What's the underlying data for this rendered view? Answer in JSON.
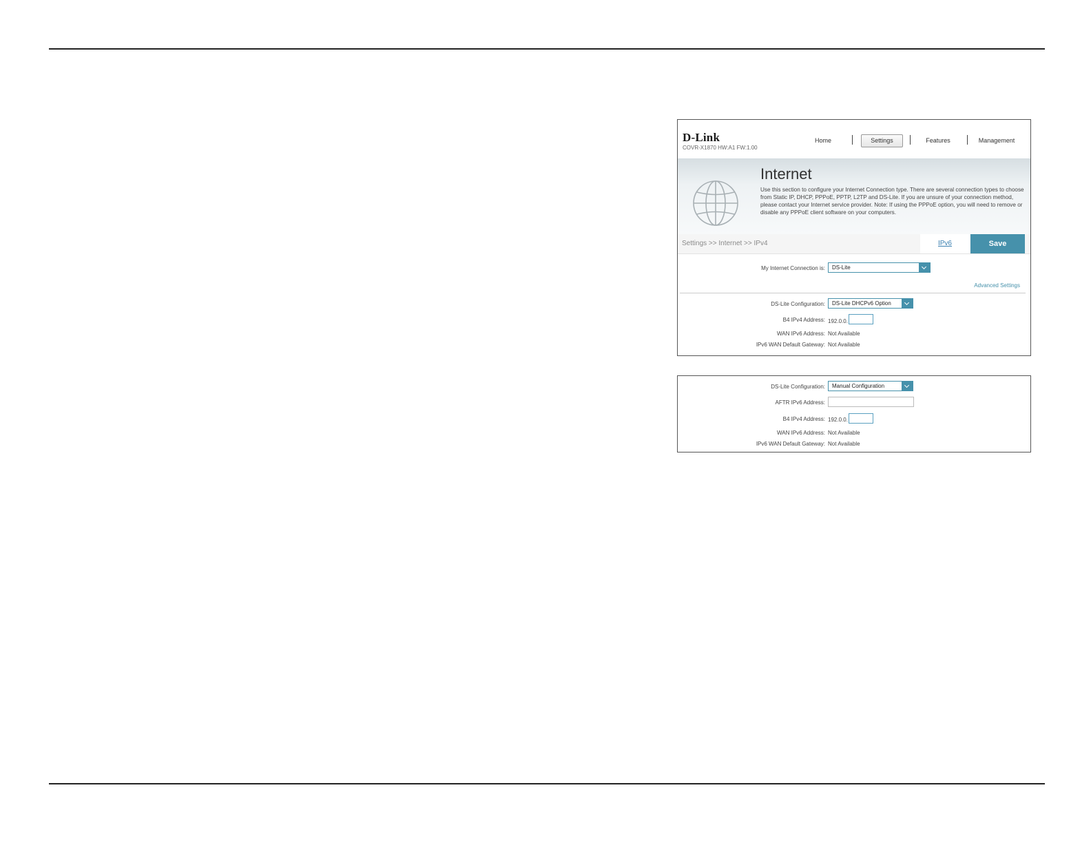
{
  "header": {
    "logo": "D-Link",
    "model": "COVR-X1870 HW:A1 FW:1.00",
    "nav": [
      "Home",
      "Settings",
      "Features",
      "Management"
    ],
    "active_nav": "Settings"
  },
  "banner": {
    "title": "Internet",
    "description": "Use this section to configure your Internet Connection type. There are several connection types to choose from Static IP, DHCP, PPPoE, PPTP, L2TP and DS-Lite. If you are unsure of your connection method, please contact your Internet service provider. Note: If using the PPPoE option, you will need to remove or disable any PPPoE client software on your computers."
  },
  "toolbar": {
    "breadcrumb": "Settings >> Internet >> IPv4",
    "ipv6_link": "IPv6",
    "save": "Save"
  },
  "connection": {
    "label": "My Internet Connection is:",
    "value": "DS-Lite",
    "advanced": "Advanced Settings"
  },
  "panel1": {
    "dslite_label": "DS-Lite Configuration:",
    "dslite_value": "DS-Lite DHCPv6 Option",
    "b4_label": "B4 IPv4 Address:",
    "b4_prefix": "192.0.0.",
    "b4_value": "",
    "wan_label": "WAN IPv6 Address:",
    "wan_value": "Not Available",
    "gw_label": "IPv6 WAN Default Gateway:",
    "gw_value": "Not Available"
  },
  "panel2": {
    "dslite_label": "DS-Lite Configuration:",
    "dslite_value": "Manual Configuration",
    "aftr_label": "AFTR IPv6 Address:",
    "aftr_value": "",
    "b4_label": "B4 IPv4 Address:",
    "b4_prefix": "192.0.0.",
    "b4_value": "",
    "wan_label": "WAN IPv6 Address:",
    "wan_value": "Not Available",
    "gw_label": "IPv6 WAN Default Gateway:",
    "gw_value": "Not Available"
  },
  "colors": {
    "accent": "#4691ab",
    "link": "#3a7fb0"
  }
}
